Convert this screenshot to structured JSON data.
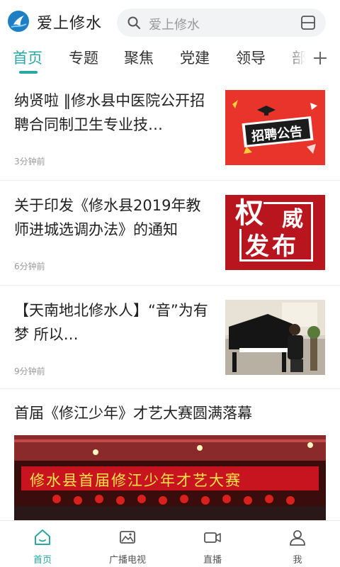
{
  "header": {
    "app_title": "爱上修水",
    "search_placeholder": "爱上修水"
  },
  "tabs": [
    {
      "label": "首页",
      "active": true
    },
    {
      "label": "专题"
    },
    {
      "label": "聚焦"
    },
    {
      "label": "党建"
    },
    {
      "label": "领导"
    },
    {
      "label": "部"
    }
  ],
  "articles": [
    {
      "title": "纳贤啦 ‖修水县中医院公开招聘合同制卫生专业技…",
      "time": "3分钟前",
      "thumb_text": "招聘公告"
    },
    {
      "title": "关于印发《修水县2019年教师进城选调办法》的通知",
      "time": "6分钟前",
      "thumb_text_1": "权",
      "thumb_text_2": "威",
      "thumb_text_3": "发布"
    },
    {
      "title": "【天南地北修水人】“音”为有梦 所以…",
      "time": "9分钟前"
    }
  ],
  "feature": {
    "title": "首届《修江少年》才艺大赛圆满落幕",
    "banner_text": "修水县首届修江少年才艺大赛"
  },
  "bottom_nav": [
    {
      "label": "首页",
      "icon": "home-icon",
      "active": true
    },
    {
      "label": "广播电视",
      "icon": "image-icon"
    },
    {
      "label": "直播",
      "icon": "video-icon"
    },
    {
      "label": "我",
      "icon": "user-icon"
    }
  ],
  "colors": {
    "accent": "#2aa8a2",
    "thumb_red": "#e8342a",
    "thumb_darkred": "#b8151e"
  }
}
